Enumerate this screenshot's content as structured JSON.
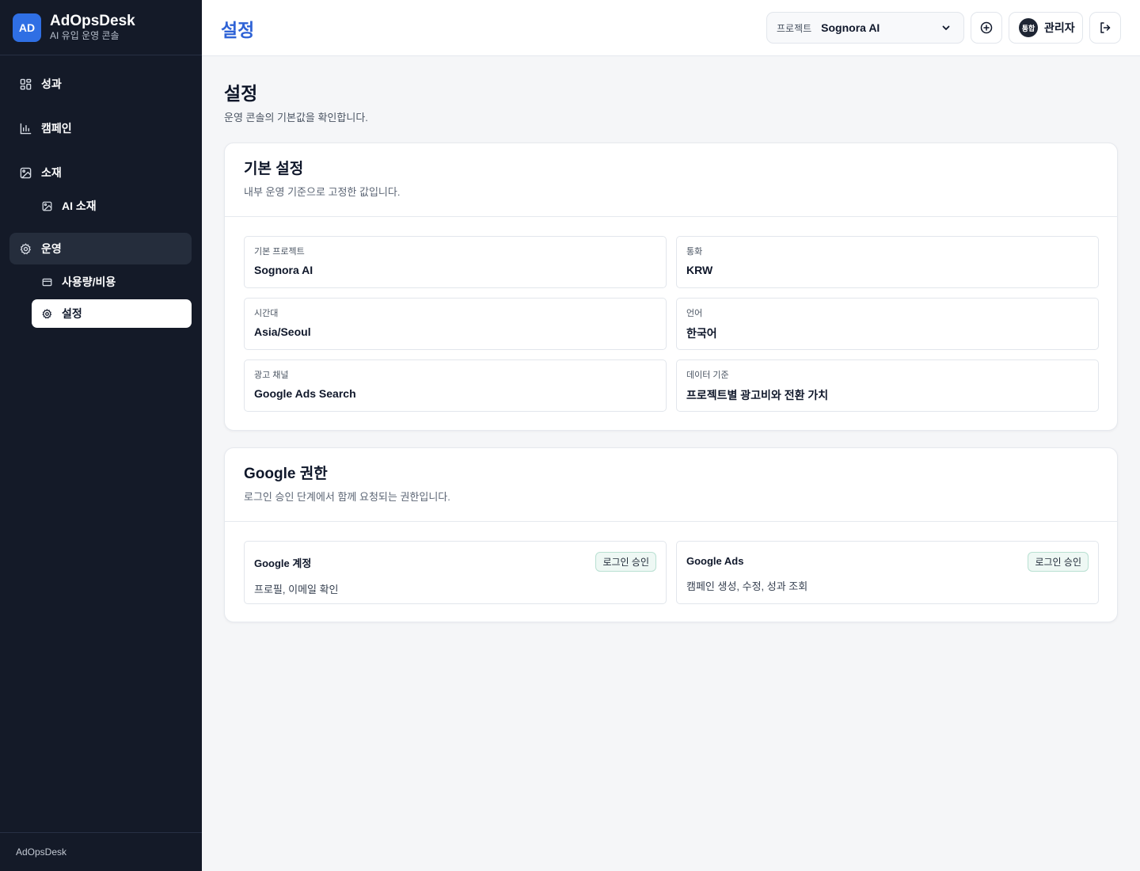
{
  "brand": {
    "logo_text": "AD",
    "name": "AdOpsDesk",
    "subtitle": "AI 유입 운영 콘솔"
  },
  "sidebar": {
    "items": [
      {
        "label": "성과",
        "icon": "dashboard-grid-icon"
      },
      {
        "label": "캠페인",
        "icon": "bar-chart-icon"
      },
      {
        "label": "소재",
        "icon": "image-icon"
      },
      {
        "label": "AI 소재",
        "icon": "image-icon"
      },
      {
        "label": "운영",
        "icon": "gear-icon"
      },
      {
        "label": "사용량/비용",
        "icon": "card-icon"
      },
      {
        "label": "설정",
        "icon": "gear-icon"
      }
    ],
    "footer": "AdOpsDesk"
  },
  "header": {
    "title": "설정",
    "project_label": "프로젝트",
    "project_value": "Sognora AI",
    "user_badge": "통합",
    "user_name": "관리자"
  },
  "page": {
    "title": "설정",
    "description": "운영 콘솔의 기본값을 확인합니다."
  },
  "basic_settings": {
    "title": "기본 설정",
    "subtitle": "내부 운영 기준으로 고정한 값입니다.",
    "fields": [
      {
        "label": "기본 프로젝트",
        "value": "Sognora AI"
      },
      {
        "label": "통화",
        "value": "KRW"
      },
      {
        "label": "시간대",
        "value": "Asia/Seoul"
      },
      {
        "label": "언어",
        "value": "한국어"
      },
      {
        "label": "광고 채널",
        "value": "Google Ads Search"
      },
      {
        "label": "데이터 기준",
        "value": "프로젝트별 광고비와 전환 가치"
      }
    ]
  },
  "google_permissions": {
    "title": "Google 권한",
    "subtitle": "로그인 승인 단계에서 함께 요청되는 권한입니다.",
    "items": [
      {
        "title": "Google 계정",
        "badge": "로그인 승인",
        "description": "프로필, 이메일 확인"
      },
      {
        "title": "Google Ads",
        "badge": "로그인 승인",
        "description": "캠페인 생성, 수정, 성과 조회"
      }
    ]
  },
  "colors": {
    "sidebar": "#141a28",
    "accent": "#2f63d6",
    "logo": "#2f6fe4",
    "badge_bg": "#eef8f4",
    "badge_border": "#b9e0d2"
  }
}
